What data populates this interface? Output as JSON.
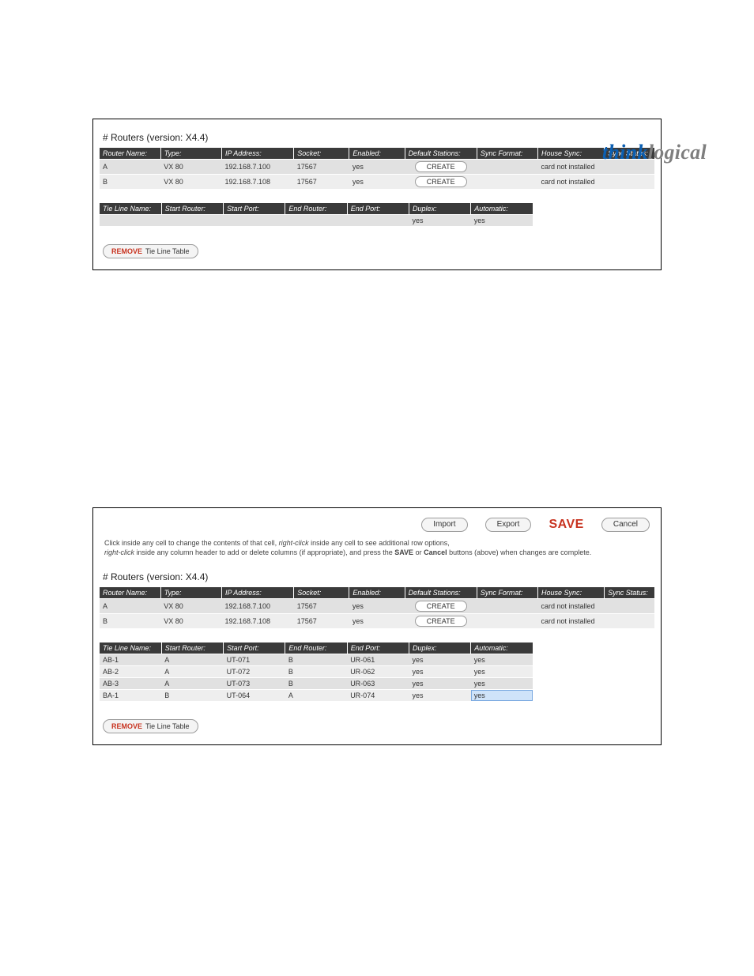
{
  "brand": {
    "part1": "think",
    "part2": "logical"
  },
  "section_title": "# Routers (version: X4.4)",
  "routers": {
    "headers": {
      "name": "Router Name:",
      "type": "Type:",
      "ip": "IP Address:",
      "socket": "Socket:",
      "enabled": "Enabled:",
      "default_stations": "Default Stations:",
      "sync_format": "Sync Format:",
      "house_sync": "House Sync:",
      "sync_status": "Sync Status:"
    },
    "rows": [
      {
        "name": "A",
        "type": "VX 80",
        "ip": "192.168.7.100",
        "socket": "17567",
        "enabled": "yes",
        "default_stations_btn": "CREATE",
        "sync_format": "",
        "house_sync": "card not installed",
        "sync_status": ""
      },
      {
        "name": "B",
        "type": "VX 80",
        "ip": "192.168.7.108",
        "socket": "17567",
        "enabled": "yes",
        "default_stations_btn": "CREATE",
        "sync_format": "",
        "house_sync": "card not installed",
        "sync_status": ""
      }
    ]
  },
  "tieline": {
    "headers": {
      "name": "Tie Line Name:",
      "start_router": "Start Router:",
      "start_port": "Start Port:",
      "end_router": "End Router:",
      "end_port": "End Port:",
      "duplex": "Duplex:",
      "automatic": "Automatic:"
    },
    "empty_row": {
      "name": "",
      "start_router": "",
      "start_port": "",
      "end_router": "",
      "end_port": "",
      "duplex": "yes",
      "automatic": "yes"
    },
    "rows": [
      {
        "name": "AB-1",
        "start_router": "A",
        "start_port": "UT-071",
        "end_router": "B",
        "end_port": "UR-061",
        "duplex": "yes",
        "automatic": "yes"
      },
      {
        "name": "AB-2",
        "start_router": "A",
        "start_port": "UT-072",
        "end_router": "B",
        "end_port": "UR-062",
        "duplex": "yes",
        "automatic": "yes"
      },
      {
        "name": "AB-3",
        "start_router": "A",
        "start_port": "UT-073",
        "end_router": "B",
        "end_port": "UR-063",
        "duplex": "yes",
        "automatic": "yes"
      },
      {
        "name": "BA-1",
        "start_router": "B",
        "start_port": "UT-064",
        "end_router": "A",
        "end_port": "UR-074",
        "duplex": "yes",
        "automatic": "yes"
      }
    ]
  },
  "toolbar": {
    "import": "Import",
    "export": "Export",
    "save": "SAVE",
    "cancel": "Cancel"
  },
  "instructions": {
    "line1a": "Click inside any cell to change the contents of that cell, ",
    "line1b_em": "right-click",
    "line1c": " inside any cell to see additional row options,",
    "line2a_em": "right-click",
    "line2b": " inside any column header to add or delete columns (if appropriate), and press the ",
    "line2c_bold": "SAVE",
    "line2d": " or ",
    "line2e_bold": "Cancel",
    "line2f": " buttons (above) when changes are complete."
  },
  "remove_btn": {
    "red": "REMOVE",
    "rest": "Tie Line Table"
  }
}
